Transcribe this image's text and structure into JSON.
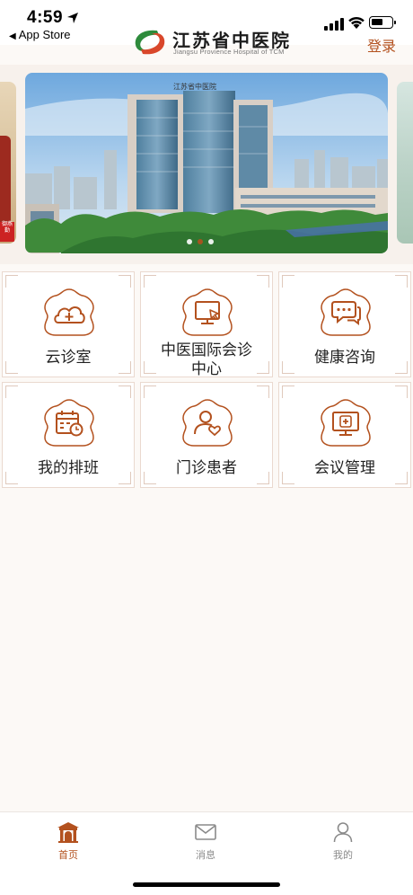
{
  "status_bar": {
    "time": "4:59",
    "back_app": "App Store"
  },
  "header": {
    "hospital_name": "江苏省中医院",
    "hospital_name_en": "Jiangsu Provience Hospital of TCM",
    "login_label": "登录"
  },
  "banner": {
    "building_sign": "江苏省中医院",
    "side_tag": "御燕勤",
    "dots_total": 3,
    "active_dot": 2
  },
  "grid": {
    "items": [
      {
        "label": "云诊室",
        "icon": "cloud-plus-icon"
      },
      {
        "label": "中医国际会诊",
        "label_line2": "中心",
        "icon": "monitor-cursor-icon"
      },
      {
        "label": "健康咨询",
        "icon": "chat-bubbles-icon"
      },
      {
        "label": "我的排班",
        "icon": "calendar-clock-icon"
      },
      {
        "label": "门诊患者",
        "icon": "patient-heart-icon"
      },
      {
        "label": "会议管理",
        "icon": "monitor-medical-icon"
      }
    ]
  },
  "tabbar": {
    "tabs": [
      {
        "label": "首页",
        "icon": "home-gate-icon",
        "active": true
      },
      {
        "label": "消息",
        "icon": "mail-icon",
        "active": false
      },
      {
        "label": "我的",
        "icon": "profile-icon",
        "active": false
      }
    ]
  },
  "colors": {
    "accent": "#b3511e",
    "logo_green": "#2e8b3c",
    "logo_red": "#d9472b",
    "background": "#fcf9f6"
  }
}
